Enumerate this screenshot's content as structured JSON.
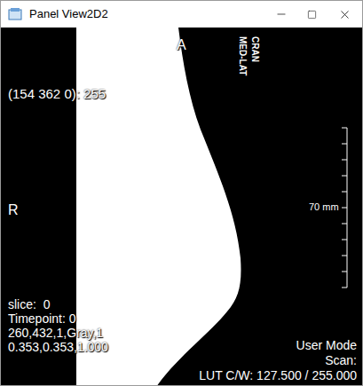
{
  "window": {
    "title": "Panel View2D2"
  },
  "viewport": {
    "orientation_top": "A",
    "orientation_left": "R",
    "view_labels": [
      "MED-LAT",
      "CRAN"
    ],
    "pixel_readout": "(154 362 0): 255",
    "scale_label": "70 mm",
    "info_left": [
      "slice:  0",
      "Timepoint: 0",
      "260,432,1,Gray,1",
      "0.353,0.353,1.000"
    ],
    "info_right": [
      "User Mode",
      "Scan:",
      "LUT C/W: 127.500 / 255.000"
    ]
  }
}
